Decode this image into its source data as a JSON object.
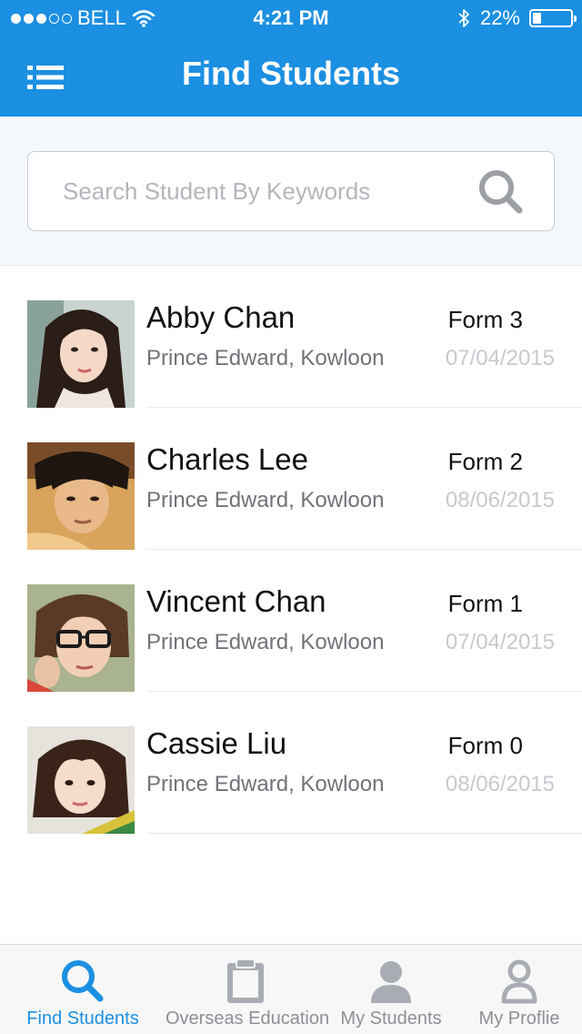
{
  "status_bar": {
    "carrier": "BELL",
    "signal_strength": 3,
    "signal_max": 5,
    "time": "4:21 PM",
    "battery_text": "22%",
    "battery_level": 0.22,
    "icons": [
      "wifi-icon",
      "bluetooth-icon",
      "battery-icon"
    ]
  },
  "header": {
    "title": "Find Students",
    "menu_icon": "list-menu-icon",
    "background_color": "#1b8fe1"
  },
  "search": {
    "placeholder": "Search Student By Keywords",
    "value": "",
    "icon": "search-icon"
  },
  "students": [
    {
      "name": "Abby Chan",
      "location": "Prince Edward, Kowloon",
      "form": "Form 3",
      "date": "07/04/2015"
    },
    {
      "name": "Charles Lee",
      "location": "Prince Edward, Kowloon",
      "form": "Form 2",
      "date": "08/06/2015"
    },
    {
      "name": "Vincent Chan",
      "location": "Prince Edward, Kowloon",
      "form": "Form 1",
      "date": "07/04/2015"
    },
    {
      "name": "Cassie Liu",
      "location": "Prince Edward, Kowloon",
      "form": "Form 0",
      "date": "08/06/2015"
    }
  ],
  "tab_bar": {
    "active_index": 0,
    "accent_color": "#1b8fe1",
    "inactive_color": "#8c9096",
    "tabs": [
      {
        "label": "Find Students",
        "icon": "search-icon"
      },
      {
        "label": "Overseas Education",
        "icon": "clipboard-icon"
      },
      {
        "label": "My Students",
        "icon": "person-icon"
      },
      {
        "label": "My Proflie",
        "icon": "profile-outline-icon"
      }
    ]
  }
}
